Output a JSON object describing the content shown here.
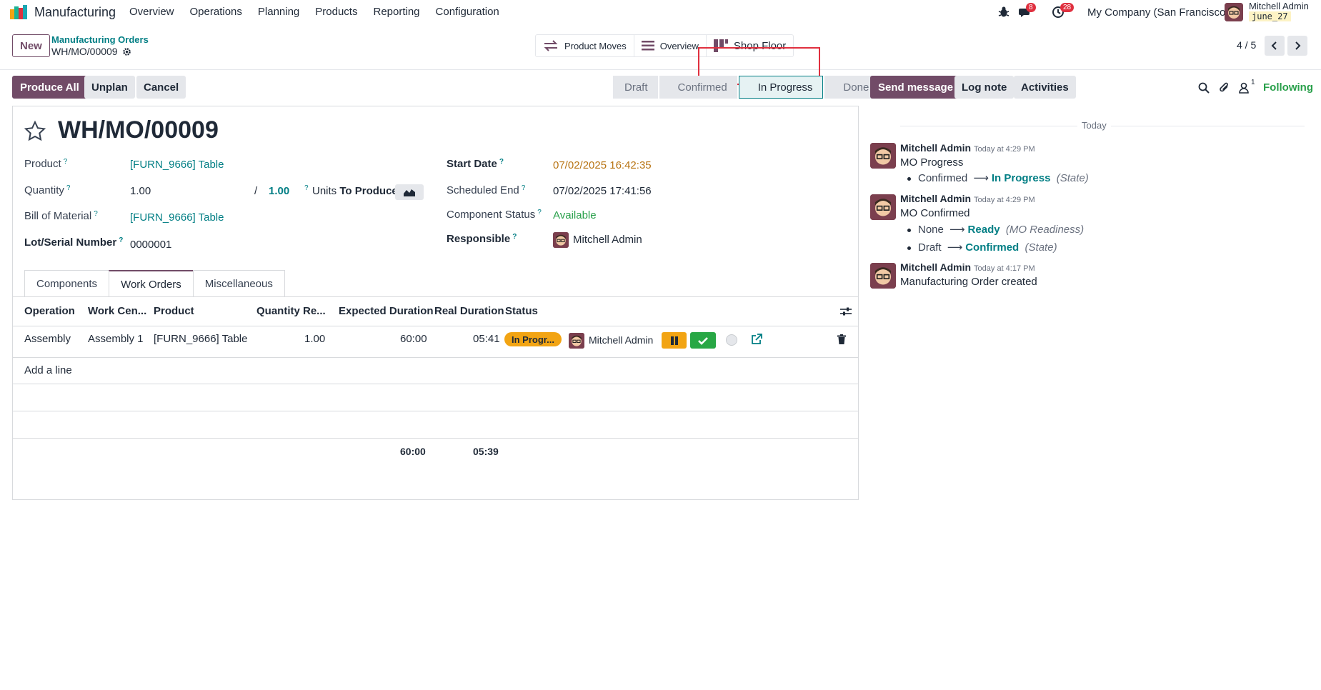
{
  "navbar": {
    "app_name": "Manufacturing",
    "menu": [
      "Overview",
      "Operations",
      "Planning",
      "Products",
      "Reporting",
      "Configuration"
    ],
    "messages_count": "8",
    "activities_count": "28",
    "company": "My Company (San Francisco)",
    "user_name": "Mitchell Admin",
    "db_name": "june_27"
  },
  "control": {
    "new_label": "New",
    "breadcrumb_parent": "Manufacturing Orders",
    "breadcrumb_current": "WH/MO/00009",
    "smart_buttons": {
      "product_moves": "Product Moves",
      "overview": "Overview",
      "shop_floor": "Shop Floor"
    },
    "pager": "4 / 5"
  },
  "actions": {
    "produce_all": "Produce All",
    "unplan": "Unplan",
    "cancel": "Cancel"
  },
  "stages": [
    "Draft",
    "Confirmed",
    "In Progress",
    "Done"
  ],
  "active_stage": "In Progress",
  "form": {
    "title": "WH/MO/00009",
    "product_label": "Product",
    "product_value": "[FURN_9666] Table",
    "quantity_label": "Quantity",
    "quantity_value": "1.00",
    "quantity_slash": "/",
    "quantity_target": "1.00",
    "uom": "Units",
    "to_produce": "To Produce",
    "bom_label": "Bill of Material",
    "bom_value": "[FURN_9666] Table",
    "lot_label": "Lot/Serial Number",
    "lot_value": "0000001",
    "start_label": "Start Date",
    "start_value": "07/02/2025 16:42:35",
    "end_label": "Scheduled End",
    "end_value": "07/02/2025 17:41:56",
    "component_label": "Component Status",
    "component_value": "Available",
    "responsible_label": "Responsible",
    "responsible_value": "Mitchell Admin",
    "help_mark": "?"
  },
  "tabs": [
    "Components",
    "Work Orders",
    "Miscellaneous"
  ],
  "active_tab": "Work Orders",
  "table": {
    "headers": [
      "Operation",
      "Work Cen...",
      "Product",
      "Quantity Re...",
      "Expected Duration",
      "Real Duration",
      "Status"
    ],
    "row": {
      "operation": "Assembly",
      "work_center": "Assembly 1",
      "product": "[FURN_9666] Table",
      "quantity": "1.00",
      "expected": "60:00",
      "real": "05:41",
      "status": "In Progr...",
      "user": "Mitchell Admin"
    },
    "add_line": "Add a line",
    "total_expected": "60:00",
    "total_real": "05:39"
  },
  "chatter": {
    "send_message": "Send message",
    "log_note": "Log note",
    "activities": "Activities",
    "followers_count": "1",
    "following": "Following",
    "today": "Today",
    "messages": [
      {
        "author": "Mitchell Admin",
        "time": "Today at 4:29 PM",
        "body": "MO Progress",
        "tracking": [
          {
            "old": "Confirmed",
            "new": "In Progress",
            "field": "(State)"
          }
        ]
      },
      {
        "author": "Mitchell Admin",
        "time": "Today at 4:29 PM",
        "body": "MO Confirmed",
        "tracking": [
          {
            "old": "None",
            "new": "Ready",
            "field": "(MO Readiness)"
          },
          {
            "old": "Draft",
            "new": "Confirmed",
            "field": "(State)"
          }
        ]
      },
      {
        "author": "Mitchell Admin",
        "time": "Today at 4:17 PM",
        "body": "Manufacturing Order created",
        "tracking": []
      }
    ]
  },
  "colors": {
    "brand": "#714b67",
    "link": "#017e84",
    "in_progress": "#f2a413",
    "success": "#28a745",
    "highlight_box": "#e0303f"
  }
}
